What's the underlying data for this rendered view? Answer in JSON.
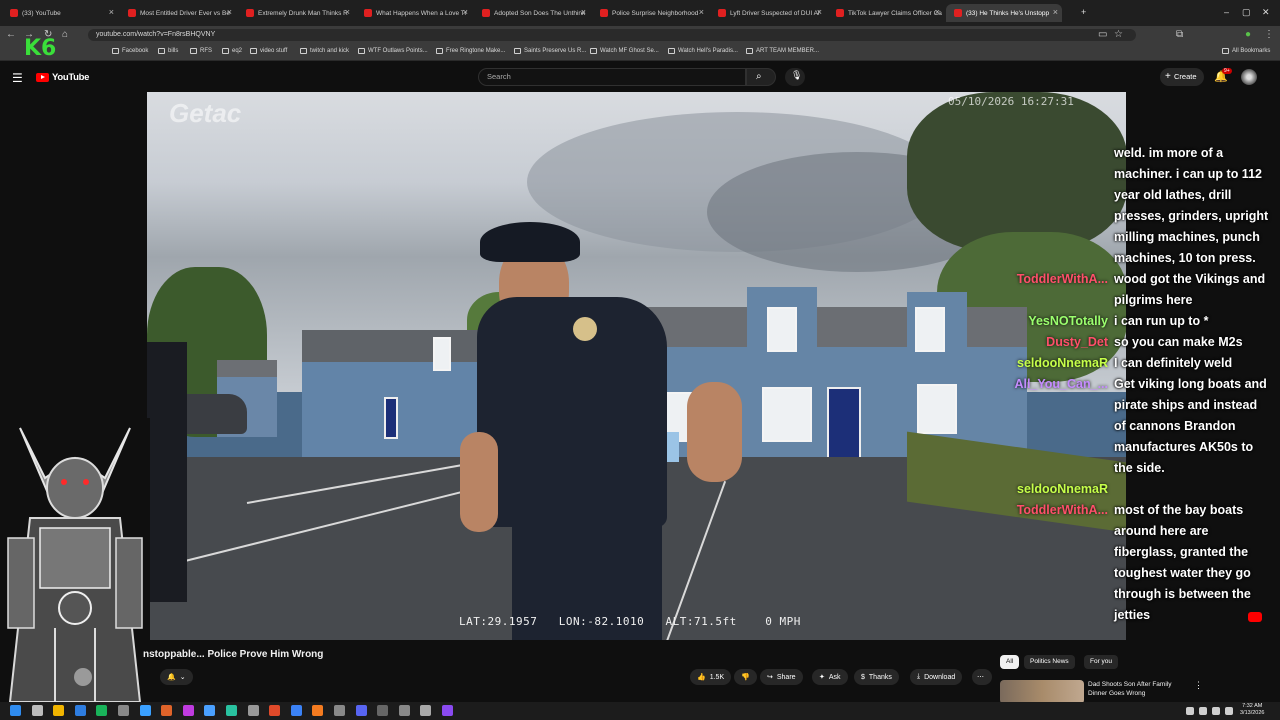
{
  "browser": {
    "tabs": [
      {
        "label": "(33) YouTube",
        "active": false
      },
      {
        "label": "Most Entitled Driver Ever vs Be",
        "active": false
      },
      {
        "label": "Extremely Drunk Man Thinks R",
        "active": false
      },
      {
        "label": "What Happens When a Love Tr",
        "active": false
      },
      {
        "label": "Adopted Son Does The Unthink",
        "active": false
      },
      {
        "label": "Police Surprise Neighborhood",
        "active": false
      },
      {
        "label": "Lyft Driver Suspected of DUI Af",
        "active": false
      },
      {
        "label": "TikTok Lawyer Claims Officer Ca",
        "active": false
      },
      {
        "label": "(33) He Thinks He's Unstopp",
        "active": true
      }
    ],
    "url": "youtube.com/watch?v=Fn8rsBHQVNY",
    "bookmarks": [
      {
        "label": "Facebook"
      },
      {
        "label": "bills"
      },
      {
        "label": "RFS"
      },
      {
        "label": "eq2"
      },
      {
        "label": "video stuff"
      },
      {
        "label": "twitch and kick"
      },
      {
        "label": "WTF Outlaws Points..."
      },
      {
        "label": "Free Ringtone Make..."
      },
      {
        "label": "Saints Preserve Us R..."
      },
      {
        "label": "Watch MF Ghost Se..."
      },
      {
        "label": "Watch Hell's Paradis..."
      },
      {
        "label": "ART TEAM MEMBER..."
      }
    ],
    "all_bookmarks": "All Bookmarks",
    "overlay_logo": "K6"
  },
  "youtube": {
    "brand": "YouTube",
    "search_placeholder": "Search",
    "create_label": "Create",
    "notification_count": "9+"
  },
  "video": {
    "watermark": "Getac",
    "timestamp": "05/10/2026 16:27:31",
    "gps": "LAT:29.1957   LON:-82.1010   ALT:71.5ft    0 MPH",
    "title": "nstoppable... Police Prove Him Wrong"
  },
  "chat": {
    "messages": [
      {
        "text": "weld. im more of a"
      },
      {
        "text": "machiner. i can up to 112"
      },
      {
        "text": "year old lathes, drill"
      },
      {
        "text": "presses, grinders, upright"
      },
      {
        "text": "milling machines, punch"
      },
      {
        "text": "machines, 10 ton press."
      },
      {
        "text": "wood got the Vikings and"
      },
      {
        "text": "pilgrims here"
      },
      {
        "text": "i can run up to *"
      },
      {
        "text": "so you can make M2s"
      },
      {
        "text": "I can definitely weld"
      },
      {
        "text": "Get viking long boats and"
      },
      {
        "text": "pirate ships and instead"
      },
      {
        "text": "of cannons Brandon"
      },
      {
        "text": "manufactures AK50s to"
      },
      {
        "text": "the side."
      },
      {
        "text": ""
      },
      {
        "text": "most of the bay boats"
      },
      {
        "text": "around here are"
      },
      {
        "text": "fiberglass, granted the"
      },
      {
        "text": "toughest water they go"
      },
      {
        "text": "through is between the"
      },
      {
        "text": "jetties"
      }
    ],
    "users": [
      {
        "name": "ToddlerWithA...",
        "color": "#ff4f6a",
        "row": 6
      },
      {
        "name": "YesNOTotally",
        "color": "#9bff6e",
        "row": 8
      },
      {
        "name": "Dusty_Det",
        "color": "#ff4f6a",
        "row": 9
      },
      {
        "name": "seldooNnemaR",
        "color": "#c6ff4a",
        "row": 10
      },
      {
        "name": "All_You_Can_...",
        "color": "#c58bff",
        "row": 11
      },
      {
        "name": "seldooNnemaR",
        "color": "#c6ff4a",
        "row": 16
      },
      {
        "name": "ToddlerWithA...",
        "color": "#ff4f6a",
        "row": 17
      }
    ]
  },
  "actions": {
    "like_count": "1.5K",
    "share": "Share",
    "ask": "Ask",
    "thanks": "Thanks",
    "download": "Download"
  },
  "chips": [
    "All",
    "Politics News",
    "For you"
  ],
  "recommendation": {
    "title": "Dad Shoots Son After Family Dinner Goes Wrong"
  },
  "clock": {
    "time": "7:32 AM",
    "date": "3/13/2026"
  },
  "colors": {
    "youtube_red": "#ff0000",
    "bg": "#0f0f0f",
    "chrome": "#3b3b3b"
  }
}
